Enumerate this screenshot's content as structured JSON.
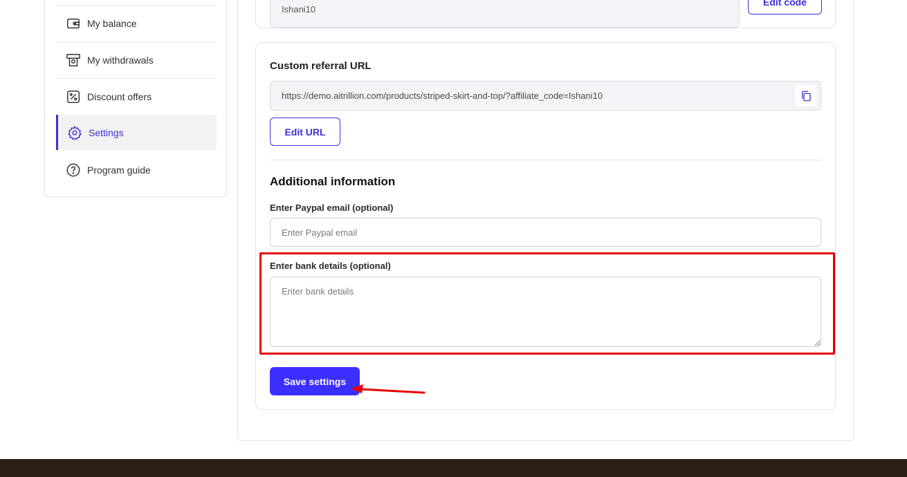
{
  "sidebar": {
    "items": [
      {
        "label": "My balance",
        "icon": "wallet-icon"
      },
      {
        "label": "My withdrawals",
        "icon": "withdrawal-icon"
      },
      {
        "label": "Discount offers",
        "icon": "percent-icon"
      },
      {
        "label": "Settings",
        "icon": "gear-icon",
        "active": true
      },
      {
        "label": "Program guide",
        "icon": "help-circle-icon"
      }
    ]
  },
  "referral_code": {
    "value": "Ishani10",
    "edit_label": "Edit code"
  },
  "custom_url": {
    "title": "Custom referral URL",
    "value": "https://demo.aitrillion.com/products/striped-skirt-and-top/?affiliate_code=Ishani10",
    "edit_label": "Edit URL"
  },
  "additional_info": {
    "title": "Additional information",
    "paypal_label": "Enter Paypal email (optional)",
    "paypal_placeholder": "Enter Paypal email",
    "bank_label": "Enter bank details (optional)",
    "bank_placeholder": "Enter bank details"
  },
  "actions": {
    "save_label": "Save settings"
  },
  "colors": {
    "accent": "#3b2fd6",
    "primary_button": "#3b2fff",
    "annotation": "#e60000",
    "footer": "#2d1f14"
  }
}
